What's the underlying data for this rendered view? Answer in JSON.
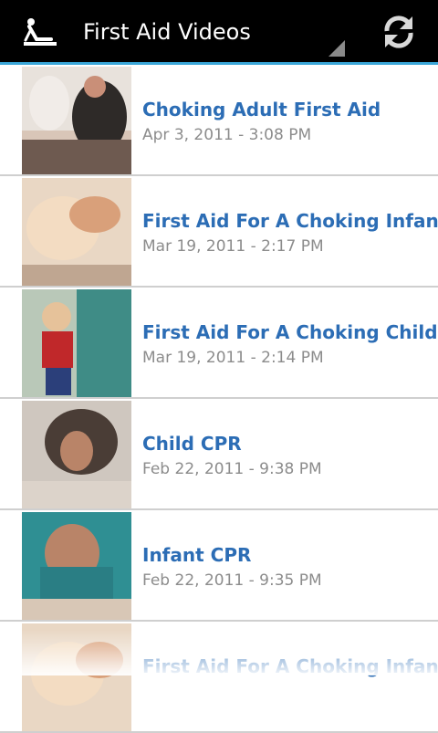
{
  "actionbar": {
    "title": "First Aid Videos",
    "app_icon": "cpr-person-icon",
    "refresh_icon": "refresh-icon",
    "accent_color": "#3aa6d8"
  },
  "videos": [
    {
      "title": "Choking Adult First Aid",
      "date": "Apr 3, 2011 - 3:08 PM"
    },
    {
      "title": "First Aid For A Choking Infant",
      "date": "Mar 19, 2011 - 2:17 PM"
    },
    {
      "title": "First Aid For A Choking Child",
      "date": "Mar 19, 2011 - 2:14 PM"
    },
    {
      "title": "Child CPR",
      "date": "Feb 22, 2011 - 9:38 PM"
    },
    {
      "title": "Infant CPR",
      "date": "Feb 22, 2011 - 9:35 PM"
    },
    {
      "title": "First Aid For A Choking Infant",
      "date": ""
    }
  ],
  "colors": {
    "title_blue": "#2c6db5",
    "date_gray": "#8c8c8c"
  }
}
